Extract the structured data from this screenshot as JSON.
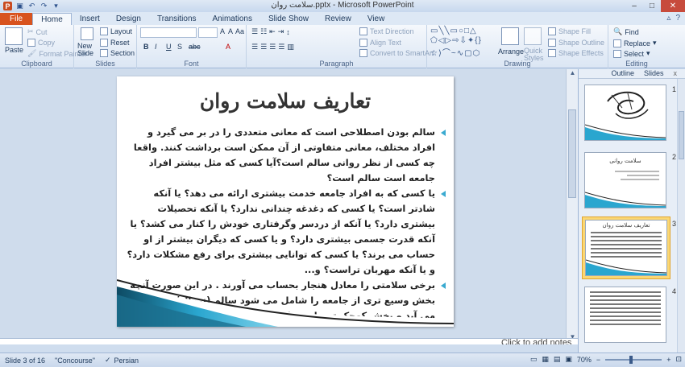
{
  "titlebar": {
    "title": "سلامت روان.pptx - Microsoft PowerPoint",
    "app_icon": "P",
    "qat": [
      "save-icon",
      "undo-icon",
      "redo-icon",
      "customize-icon"
    ],
    "minimize": "–",
    "maximize": "□",
    "close": "✕"
  },
  "tabs": [
    "File",
    "Home",
    "Insert",
    "Design",
    "Transitions",
    "Animations",
    "Slide Show",
    "Review",
    "View"
  ],
  "active_tab": "Home",
  "ribbon": {
    "clipboard": {
      "label": "Clipboard",
      "paste": "Paste",
      "cut": "Cut",
      "copy": "Copy",
      "format_painter": "Format Painter"
    },
    "slides": {
      "label": "Slides",
      "new_slide": "New Slide",
      "layout": "Layout",
      "reset": "Reset",
      "section": "Section"
    },
    "font": {
      "label": "Font",
      "bold": "B",
      "italic": "I",
      "underline": "U",
      "strike": "S",
      "abc": "abc",
      "size_up": "A",
      "size_down": "A",
      "clear": "Aa",
      "color": "A"
    },
    "paragraph": {
      "label": "Paragraph",
      "text_direction": "Text Direction",
      "align_text": "Align Text",
      "smartart": "Convert to SmartArt"
    },
    "drawing": {
      "label": "Drawing",
      "arrange": "Arrange",
      "quick_styles": "Quick Styles",
      "shape_fill": "Shape Fill",
      "shape_outline": "Shape Outline",
      "shape_effects": "Shape Effects"
    },
    "editing": {
      "label": "Editing",
      "find": "Find",
      "replace": "Replace",
      "select": "Select"
    }
  },
  "slide": {
    "title": "تعاریف سلامت روان",
    "bullets": [
      "سالم بودن اصطلاحی است که معانی متعددی را در بر می گیرد و افراد مختلف، معانی متفاوتی از آن ممکن است برداشت کنند. واقعا چه کسی از نظر روانی سالم است؟آیا کسی که مثل بیشتر افراد جامعه است سالم است؟",
      "یا کسی که به افراد جامعه خدمت بیشتری ارائه می دهد؟ یا آنکه شادتر است؟ یا کسی که دغدغه چندانی ندارد؟ یا آنکه تحصیلات بیشتری دارد؟ یا آنکه از دردسر وگرفتاری خودش را کنار می کشد؟ یا آنکه قدرت جسمی بیشتری دارد؟ و یا کسی که دیگران بیشتر از او حساب می برند؟ یا کسی که توانایی بیشتری برای رفع مشکلات دارد؟ و یا آنکه مهربان تراست؟ و...",
      "برخی سلامتی را معادل هنجار بحساب می آورند . در این صورت آنچه بخش وسیع تری از جامعه را شامل می شود سالم (نرمال) به حساب می آید و بخش کوچک تر جامعه ناسالم (ناهنجار) تلقی می شود. بعنوان مثال در این"
    ]
  },
  "notes_placeholder": "Click to add notes",
  "panel": {
    "tabs": [
      "Outline",
      "Slides"
    ],
    "close": "x",
    "thumbnails": [
      {
        "num": "1",
        "title": ""
      },
      {
        "num": "2",
        "title": "سلامت روانی"
      },
      {
        "num": "3",
        "title": "تعاریف سلامت روان"
      },
      {
        "num": "4",
        "title": ""
      }
    ]
  },
  "status": {
    "slide_info": "Slide 3 of 16",
    "theme": "\"Concourse\"",
    "language": "Persian",
    "zoom": "70%"
  }
}
